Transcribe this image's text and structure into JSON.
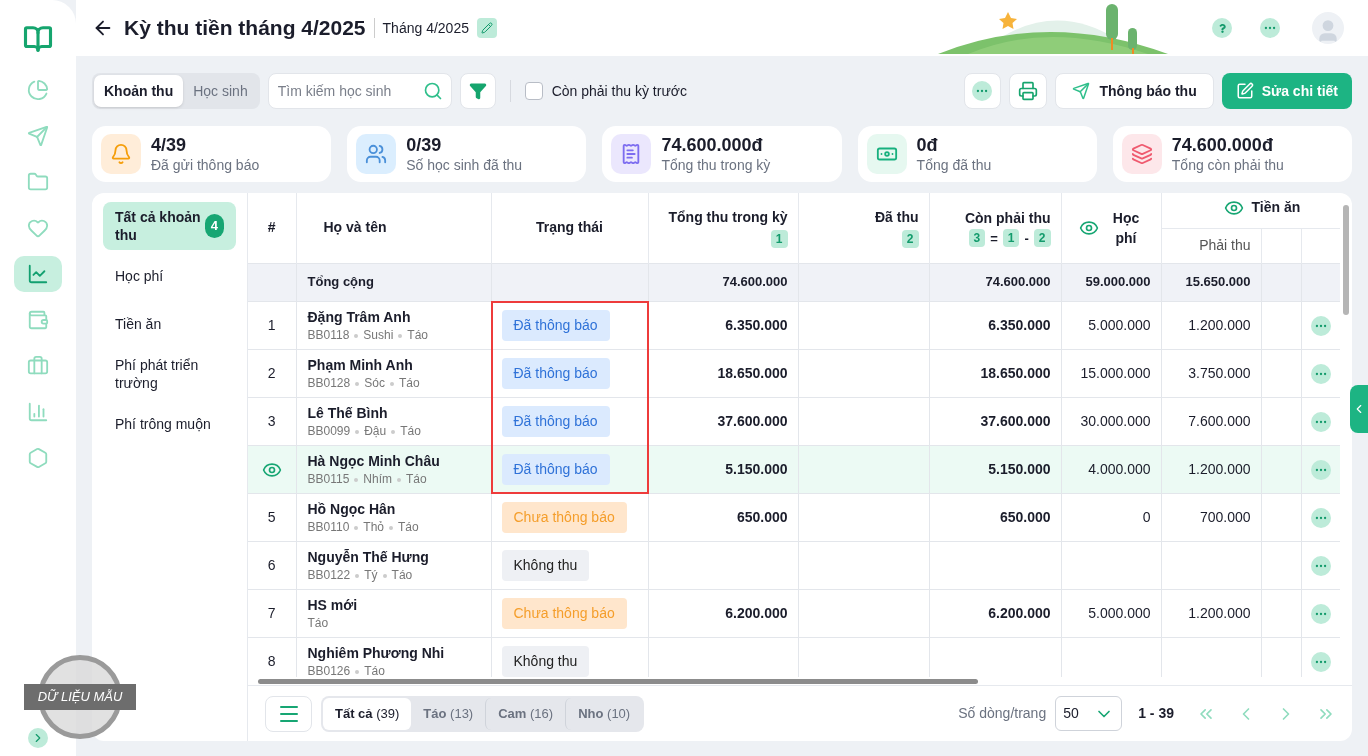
{
  "sidebar": {
    "items": [
      {
        "kind": "pie",
        "selected": false
      },
      {
        "kind": "send",
        "selected": false
      },
      {
        "kind": "folder",
        "selected": false
      },
      {
        "kind": "heart",
        "selected": false
      },
      {
        "kind": "chart",
        "selected": true
      },
      {
        "kind": "wallet",
        "selected": false
      },
      {
        "kind": "briefcase",
        "selected": false
      },
      {
        "kind": "bars",
        "selected": false
      },
      {
        "kind": "hexagon",
        "selected": false
      }
    ]
  },
  "header": {
    "title": "Kỳ thu tiền tháng 4/2025",
    "subtitle": "Tháng 4/2025"
  },
  "toolbar": {
    "view_tabs": [
      {
        "label": "Khoản thu",
        "selected": true
      },
      {
        "label": "Học sinh",
        "selected": false
      }
    ],
    "search": {
      "placeholder": "Tìm kiếm học sinh"
    },
    "checkbox": {
      "label": "Còn phải thu kỳ trước",
      "checked": false
    },
    "notify_button": "Thông báo thu",
    "edit_button": "Sửa chi tiết"
  },
  "stats": [
    {
      "kind": "bell",
      "value": "4/39",
      "label": "Đã gửi thông báo"
    },
    {
      "kind": "people",
      "value": "0/39",
      "label": "Số học sinh đã thu"
    },
    {
      "kind": "receipt",
      "value": "74.600.000đ",
      "label": "Tổng thu trong kỳ"
    },
    {
      "kind": "money",
      "value": "0đ",
      "label": "Tổng đã thu"
    },
    {
      "kind": "stack",
      "value": "74.600.000đ",
      "label": "Tổng còn phải thu"
    }
  ],
  "categories": [
    {
      "label": "Tất cả khoản thu",
      "count": "4",
      "selected": true
    },
    {
      "label": "Học phí",
      "selected": false
    },
    {
      "label": "Tiền ăn",
      "selected": false
    },
    {
      "label": "Phí phát triển trường",
      "selected": false
    },
    {
      "label": "Phí trông muộn",
      "selected": false
    }
  ],
  "table": {
    "columns": {
      "index": "#",
      "name": "Họ và tên",
      "status": "Trạng thái",
      "total": {
        "label": "Tổng thu trong kỳ",
        "badge": "1"
      },
      "paid": {
        "label": "Đã thu",
        "badge": "2"
      },
      "remaining": {
        "label": "Còn phải thu",
        "formula": [
          "3",
          "=",
          "1",
          "-",
          "2"
        ]
      },
      "tuition": "Học phí",
      "meals": {
        "label": "Tiền ăn",
        "sub": "Phải thu"
      }
    },
    "total_row": {
      "label": "Tổng cộng",
      "total": "74.600.000",
      "remaining": "74.600.000",
      "tuition": "59.000.000",
      "meals": "15.650.000"
    },
    "rows": [
      {
        "index": "1",
        "selected": false,
        "highlighted": true,
        "name": "Đặng Trâm Anh",
        "meta": [
          "BB0118",
          "Sushi",
          "Táo"
        ],
        "status": {
          "kind": "notified",
          "label": "Đã thông báo"
        },
        "total": "6.350.000",
        "remaining": "6.350.000",
        "tuition": "5.000.000",
        "meals": "1.200.000"
      },
      {
        "index": "2",
        "selected": false,
        "highlighted": true,
        "name": "Phạm Minh Anh",
        "meta": [
          "BB0128",
          "Sóc",
          "Táo"
        ],
        "status": {
          "kind": "notified",
          "label": "Đã thông báo"
        },
        "total": "18.650.000",
        "remaining": "18.650.000",
        "tuition": "15.000.000",
        "meals": "3.750.000"
      },
      {
        "index": "3",
        "selected": false,
        "highlighted": true,
        "name": "Lê Thế Bình",
        "meta": [
          "BB0099",
          "Đậu",
          "Táo"
        ],
        "status": {
          "kind": "notified",
          "label": "Đã thông báo"
        },
        "total": "37.600.000",
        "remaining": "37.600.000",
        "tuition": "30.000.000",
        "meals": "7.600.000"
      },
      {
        "selected": true,
        "highlighted": true,
        "name": "Hà Ngọc Minh Châu",
        "meta": [
          "BB0115",
          "Nhím",
          "Táo"
        ],
        "status": {
          "kind": "notified",
          "label": "Đã thông báo"
        },
        "total": "5.150.000",
        "remaining": "5.150.000",
        "tuition": "4.000.000",
        "meals": "1.200.000"
      },
      {
        "index": "5",
        "selected": false,
        "highlighted": false,
        "name": "Hồ Ngọc Hân",
        "meta": [
          "BB0110",
          "Thỏ",
          "Táo"
        ],
        "status": {
          "kind": "pending",
          "label": "Chưa thông báo"
        },
        "total": "650.000",
        "remaining": "650.000",
        "tuition": "0",
        "meals": "700.000"
      },
      {
        "index": "6",
        "selected": false,
        "highlighted": false,
        "name": "Nguyễn Thế Hưng",
        "meta": [
          "BB0122",
          "Tý",
          "Táo"
        ],
        "status": {
          "kind": "none",
          "label": "Không thu"
        }
      },
      {
        "index": "7",
        "selected": false,
        "highlighted": false,
        "name": "HS mới",
        "meta": [
          "Táo"
        ],
        "status": {
          "kind": "pending",
          "label": "Chưa thông báo"
        },
        "total": "6.200.000",
        "remaining": "6.200.000",
        "tuition": "5.000.000",
        "meals": "1.200.000"
      },
      {
        "index": "8",
        "selected": false,
        "highlighted": false,
        "name": "Nghiêm Phương Nhi",
        "meta": [
          "BB0126",
          "Táo"
        ],
        "status": {
          "kind": "none",
          "label": "Không thu"
        }
      }
    ]
  },
  "footer": {
    "groups": [
      {
        "label": "Tất cả",
        "count": "(39)",
        "selected": true
      },
      {
        "label": "Táo",
        "count": "(13)",
        "selected": false
      },
      {
        "label": "Cam",
        "count": "(16)",
        "selected": false
      },
      {
        "label": "Nho",
        "count": "(10)",
        "selected": false
      }
    ],
    "rows_label": "Số dòng/trang",
    "rows_value": "50",
    "range": "1 - 39"
  },
  "stamp": "DỮ LIỆU MẪU"
}
